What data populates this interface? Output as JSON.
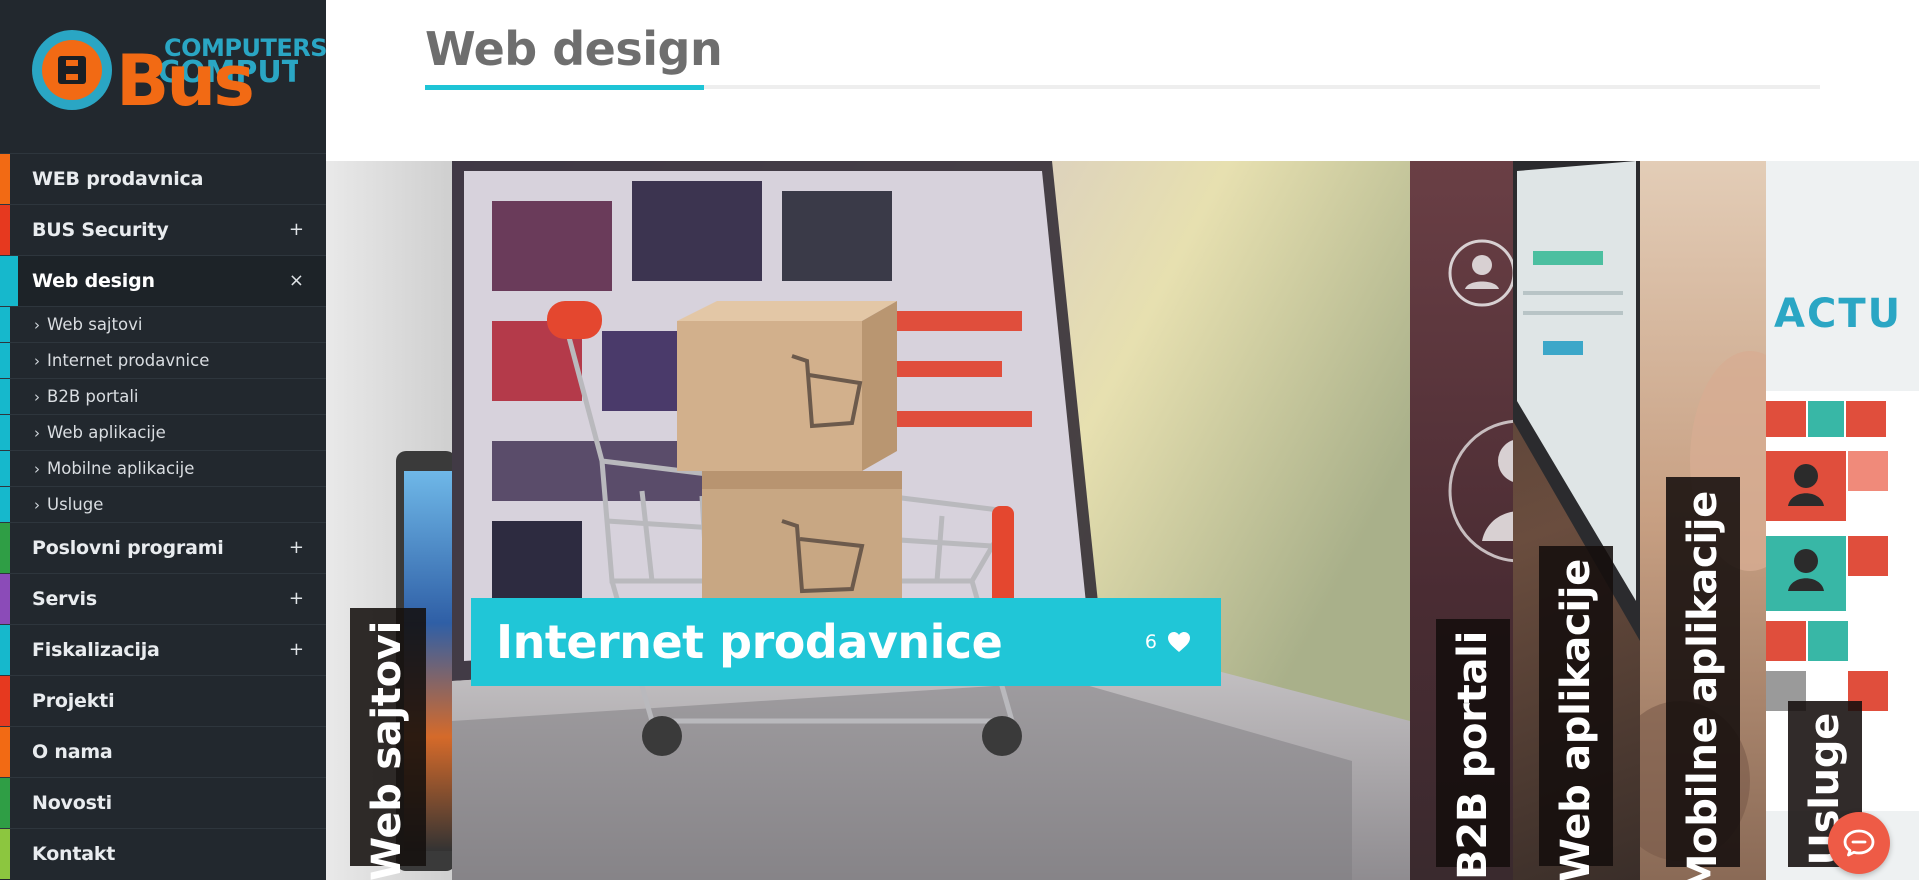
{
  "brand": {
    "logo_text_top": "COMPUTERS",
    "logo_text_main": "Bus"
  },
  "sidebar": {
    "items": [
      {
        "label": "WEB prodavnica",
        "accent": "#f26a14",
        "toggle": ""
      },
      {
        "label": "BUS Security",
        "accent": "#e6391f",
        "toggle": "+"
      },
      {
        "label": "Web design",
        "accent": "#16b8cc",
        "toggle": "×",
        "active": true
      },
      {
        "label": "Poslovni programi",
        "accent": "#2f9e45",
        "toggle": "+"
      },
      {
        "label": "Servis",
        "accent": "#8b4bb8",
        "toggle": "+"
      },
      {
        "label": "Fiskalizacija",
        "accent": "#16b8cc",
        "toggle": "+"
      },
      {
        "label": "Projekti",
        "accent": "#e6391f",
        "toggle": ""
      },
      {
        "label": "O nama",
        "accent": "#f26a14",
        "toggle": ""
      },
      {
        "label": "Novosti",
        "accent": "#2f9e45",
        "toggle": ""
      },
      {
        "label": "Kontakt",
        "accent": "#8cc63f",
        "toggle": ""
      }
    ],
    "subitems": [
      {
        "label": "Web sajtovi",
        "chevron": "›"
      },
      {
        "label": "Internet prodavnice",
        "chevron": "›"
      },
      {
        "label": "B2B portali",
        "chevron": "›"
      },
      {
        "label": "Web aplikacije",
        "chevron": "›"
      },
      {
        "label": "Mobilne aplikacije",
        "chevron": "›"
      },
      {
        "label": "Usluge",
        "chevron": "›"
      }
    ]
  },
  "header": {
    "title": "Web design"
  },
  "slider": {
    "panels": [
      {
        "label": "Web sajtovi"
      },
      {
        "label": "Internet prodavnice",
        "likes": "6"
      },
      {
        "label": "B2B portali"
      },
      {
        "label": "Web aplikacije"
      },
      {
        "label": "Mobilne aplikacije"
      },
      {
        "label": "Usluge"
      }
    ],
    "usluge_brand_fragment": "ACTU"
  },
  "colors": {
    "accent": "#20c6d7",
    "sidebar_bg": "#22282e",
    "brand_orange": "#f26a14",
    "brand_teal": "#2aa6c4"
  },
  "icons": {
    "heart": "heart-icon",
    "chat": "chat-icon"
  }
}
